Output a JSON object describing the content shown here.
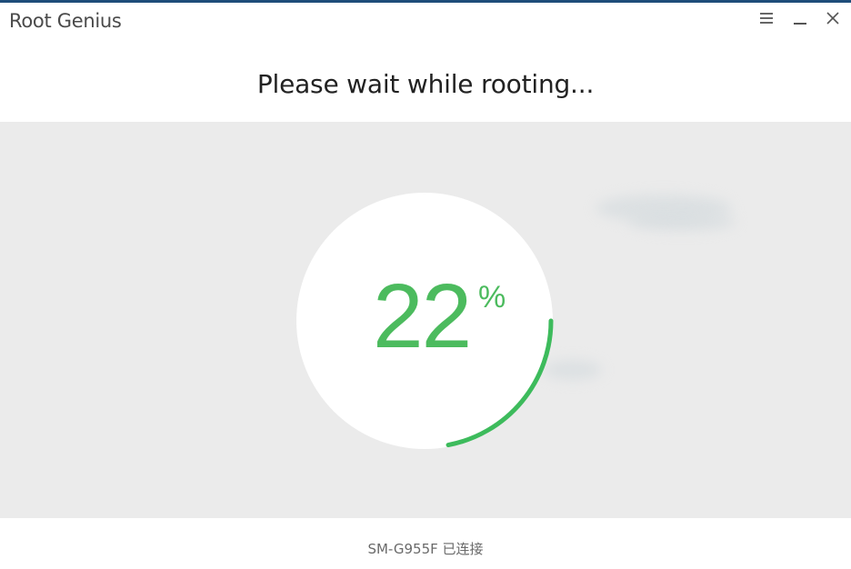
{
  "window": {
    "title": "Root Genius"
  },
  "controls": {
    "menu_icon": "hamburger-menu-icon",
    "minimize_icon": "minimize-icon",
    "close_icon": "close-icon"
  },
  "main": {
    "heading": "Please wait while rooting...",
    "progress": {
      "percent_text": "22",
      "unit": "%",
      "value": 0.22
    }
  },
  "status": {
    "device_text": "SM-G955F 已连接"
  },
  "colors": {
    "accent": "#1e4d7a",
    "progress_green": "#3dbb5c",
    "panel_bg": "#ebebeb",
    "circle_bg": "#ffffff"
  }
}
